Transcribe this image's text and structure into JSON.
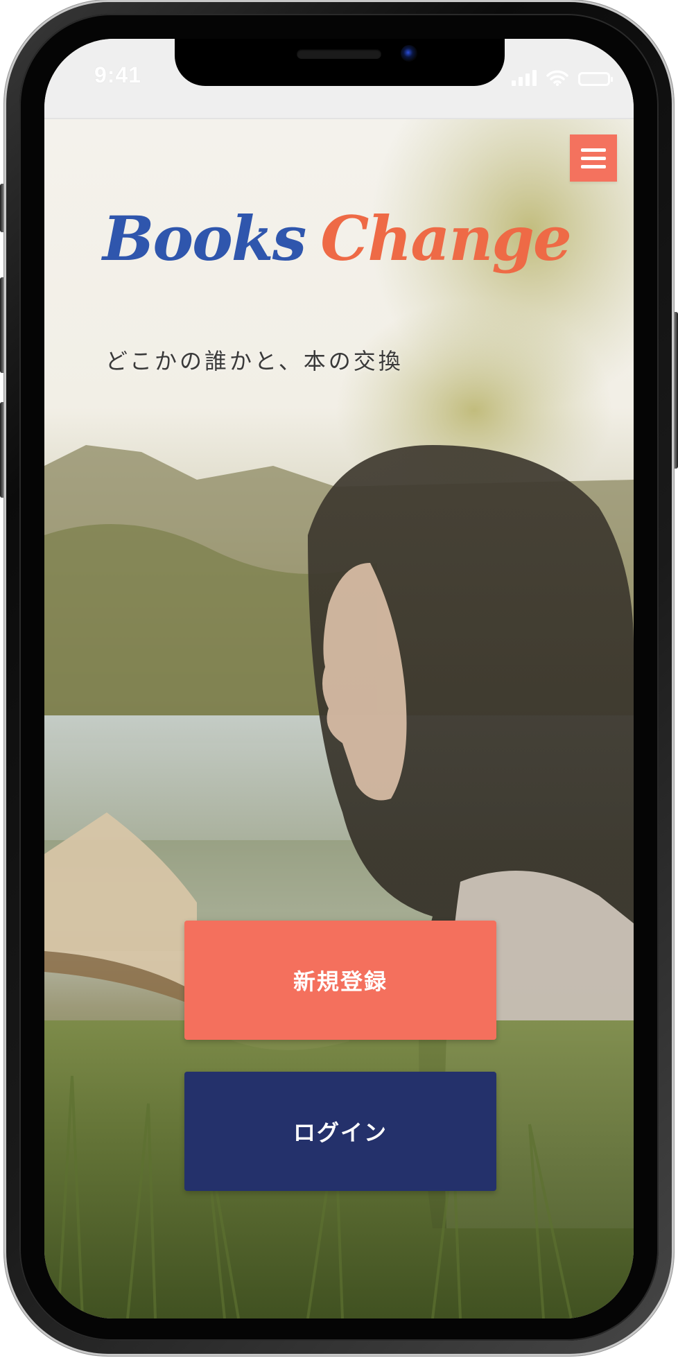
{
  "status_bar": {
    "time": "9:41",
    "icons": [
      "cellular-signal-icon",
      "wifi-icon",
      "battery-icon"
    ]
  },
  "header": {
    "menu_icon": "hamburger-menu-icon"
  },
  "brand": {
    "word_1": "Books",
    "word_2": "Change",
    "tagline": "どこかの誰かと、本の交換"
  },
  "actions": {
    "signup_label": "新規登録",
    "login_label": "ログイン"
  },
  "colors": {
    "accent_coral": "#f4705d",
    "navy": "#24316b",
    "logo_blue": "#2f56ad",
    "logo_orange": "#ee6a46"
  }
}
